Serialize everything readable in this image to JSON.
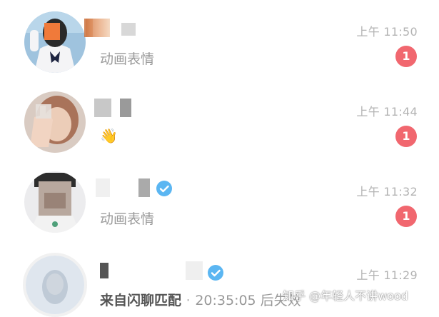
{
  "chats": [
    {
      "time": "上午 11:50",
      "preview": "动画表情",
      "unread": "1"
    },
    {
      "time": "上午 11:44",
      "preview_icon": "waving-hand-icon",
      "preview_emoji": "👋",
      "unread": "1"
    },
    {
      "time": "上午 11:32",
      "preview": "动画表情",
      "unread": "1",
      "verified": true
    },
    {
      "time": "上午 11:29",
      "preview": "来自闪聊匹配",
      "preview_separator": "·",
      "preview_detail": "20:35:05 后失效",
      "verified": true
    }
  ],
  "watermark": "知乎 @年轻人不讲wood",
  "colors": {
    "badge": "#f1676f",
    "verified": "#5bb6f2",
    "time": "#b3b3b3",
    "preview": "#9a9a9a"
  }
}
